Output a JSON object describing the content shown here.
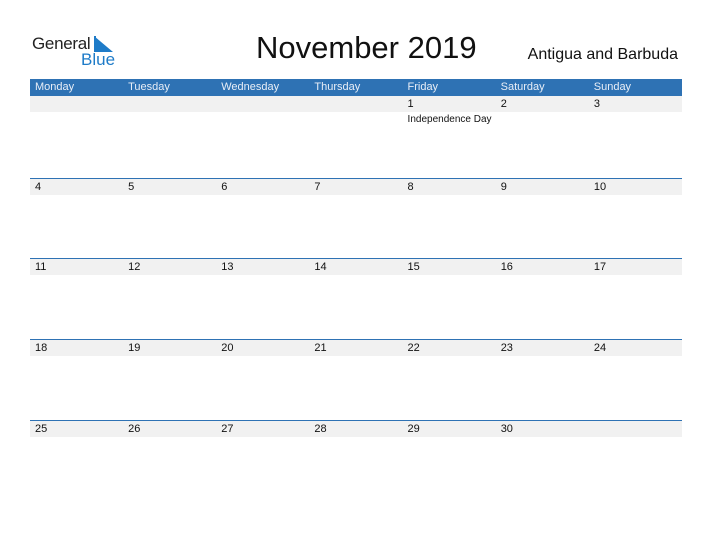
{
  "logo": {
    "word1": "General",
    "word2": "Blue",
    "icon": "triangle-flag-icon",
    "accent": "#1e7bc8"
  },
  "title": "November 2019",
  "country": "Antigua and Barbuda",
  "colors": {
    "header_bg": "#2e72b4",
    "strip_bg": "#f1f1f1"
  },
  "weekdays": [
    "Monday",
    "Tuesday",
    "Wednesday",
    "Thursday",
    "Friday",
    "Saturday",
    "Sunday"
  ],
  "weeks": [
    {
      "days": [
        {
          "num": "",
          "event": ""
        },
        {
          "num": "",
          "event": ""
        },
        {
          "num": "",
          "event": ""
        },
        {
          "num": "",
          "event": ""
        },
        {
          "num": "1",
          "event": "Independence Day"
        },
        {
          "num": "2",
          "event": ""
        },
        {
          "num": "3",
          "event": ""
        }
      ]
    },
    {
      "days": [
        {
          "num": "4",
          "event": ""
        },
        {
          "num": "5",
          "event": ""
        },
        {
          "num": "6",
          "event": ""
        },
        {
          "num": "7",
          "event": ""
        },
        {
          "num": "8",
          "event": ""
        },
        {
          "num": "9",
          "event": ""
        },
        {
          "num": "10",
          "event": ""
        }
      ]
    },
    {
      "days": [
        {
          "num": "11",
          "event": ""
        },
        {
          "num": "12",
          "event": ""
        },
        {
          "num": "13",
          "event": ""
        },
        {
          "num": "14",
          "event": ""
        },
        {
          "num": "15",
          "event": ""
        },
        {
          "num": "16",
          "event": ""
        },
        {
          "num": "17",
          "event": ""
        }
      ]
    },
    {
      "days": [
        {
          "num": "18",
          "event": ""
        },
        {
          "num": "19",
          "event": ""
        },
        {
          "num": "20",
          "event": ""
        },
        {
          "num": "21",
          "event": ""
        },
        {
          "num": "22",
          "event": ""
        },
        {
          "num": "23",
          "event": ""
        },
        {
          "num": "24",
          "event": ""
        }
      ]
    },
    {
      "days": [
        {
          "num": "25",
          "event": ""
        },
        {
          "num": "26",
          "event": ""
        },
        {
          "num": "27",
          "event": ""
        },
        {
          "num": "28",
          "event": ""
        },
        {
          "num": "29",
          "event": ""
        },
        {
          "num": "30",
          "event": ""
        },
        {
          "num": "",
          "event": ""
        }
      ]
    }
  ]
}
